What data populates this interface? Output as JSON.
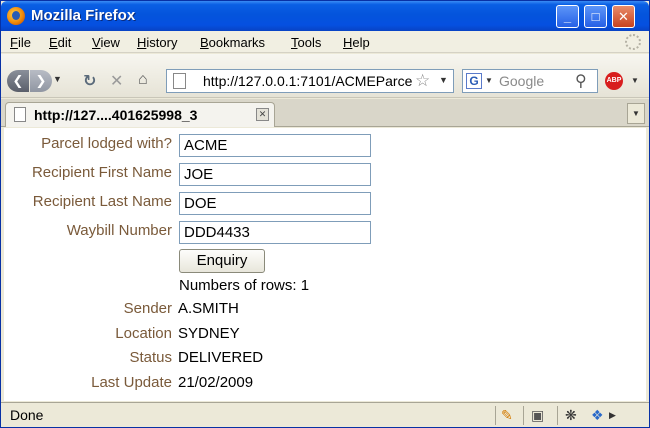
{
  "window": {
    "title": "Mozilla Firefox",
    "controls": {
      "minimize": "_",
      "maximize": "□",
      "close": "✕"
    }
  },
  "menu": {
    "items": [
      "File",
      "Edit",
      "View",
      "History",
      "Bookmarks",
      "Tools",
      "Help"
    ]
  },
  "toolbar": {
    "url": "http://127.0.0.1:7101/ACMEParcel",
    "search_placeholder": "Google",
    "abp_label": "ABP"
  },
  "tabs": [
    {
      "label": "http://127....401625998_3"
    }
  ],
  "form": {
    "parcel_lodged_label": "Parcel lodged with?",
    "parcel_lodged_value": "ACME",
    "first_name_label": "Recipient First Name",
    "first_name_value": "JOE",
    "last_name_label": "Recipient Last Name",
    "last_name_value": "DOE",
    "waybill_label": "Waybill Number",
    "waybill_value": "DDD4433",
    "enquiry_label": "Enquiry"
  },
  "results": {
    "rows_text": "Numbers of rows: 1",
    "sender_label": "Sender",
    "sender_value": "A.SMITH",
    "location_label": "Location",
    "location_value": "SYDNEY",
    "status_label": "Status",
    "status_value": "DELIVERED",
    "last_update_label": "Last Update",
    "last_update_value": "21/02/2009"
  },
  "statusbar": {
    "text": "Done"
  }
}
